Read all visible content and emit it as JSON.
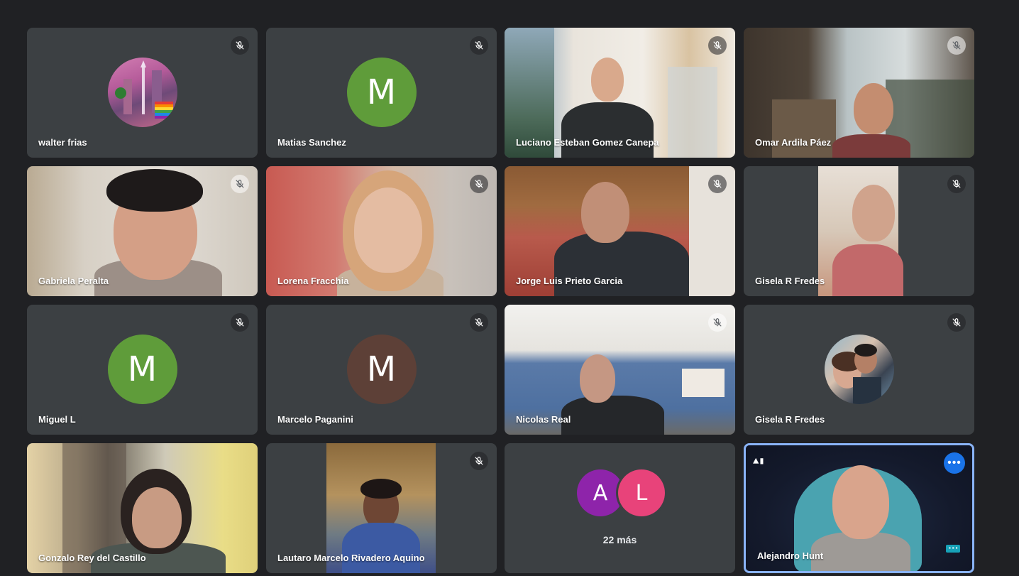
{
  "participants": [
    {
      "name": "walter frias",
      "type": "avatar-image",
      "muted": true
    },
    {
      "name": "Matias Sanchez",
      "type": "initial",
      "initial": "M",
      "color": "#5f9c3a",
      "muted": true
    },
    {
      "name": "Luciano Esteban Gomez Canepa",
      "type": "video",
      "muted": true
    },
    {
      "name": "Omar Ardila Páez",
      "type": "video",
      "muted": true
    },
    {
      "name": "Gabriela Peralta",
      "type": "video",
      "muted": true
    },
    {
      "name": "Lorena Fracchia",
      "type": "video",
      "muted": true
    },
    {
      "name": "Jorge Luis Prieto Garcia",
      "type": "video",
      "muted": true
    },
    {
      "name": "Gisela R Fredes",
      "type": "video",
      "muted": true
    },
    {
      "name": "Miguel L",
      "type": "initial",
      "initial": "M",
      "color": "#5f9c3a",
      "muted": true
    },
    {
      "name": "Marcelo Paganini",
      "type": "initial",
      "initial": "M",
      "color": "#5d4037",
      "muted": true
    },
    {
      "name": "Nicolas Real",
      "type": "video",
      "muted": true
    },
    {
      "name": "Gisela R Fredes",
      "type": "avatar-image",
      "muted": true
    },
    {
      "name": "Gonzalo Rey del Castillo",
      "type": "video",
      "muted": false
    },
    {
      "name": "Lautaro Marcelo Rivadero Aquino",
      "type": "video",
      "muted": true
    },
    {
      "name": "Alejandro Hunt",
      "type": "video",
      "muted": false,
      "active_speaker": true
    }
  ],
  "overflow": {
    "avatars": [
      {
        "initial": "A",
        "color": "#8e24aa"
      },
      {
        "initial": "L",
        "color": "#e8437a"
      }
    ],
    "label": "22 más"
  },
  "icons": {
    "mic_off": "mic-off-icon",
    "more_options": "more-options-icon"
  },
  "colors": {
    "background": "#202124",
    "tile": "#3c4043",
    "active_border": "#8ab4f8"
  }
}
